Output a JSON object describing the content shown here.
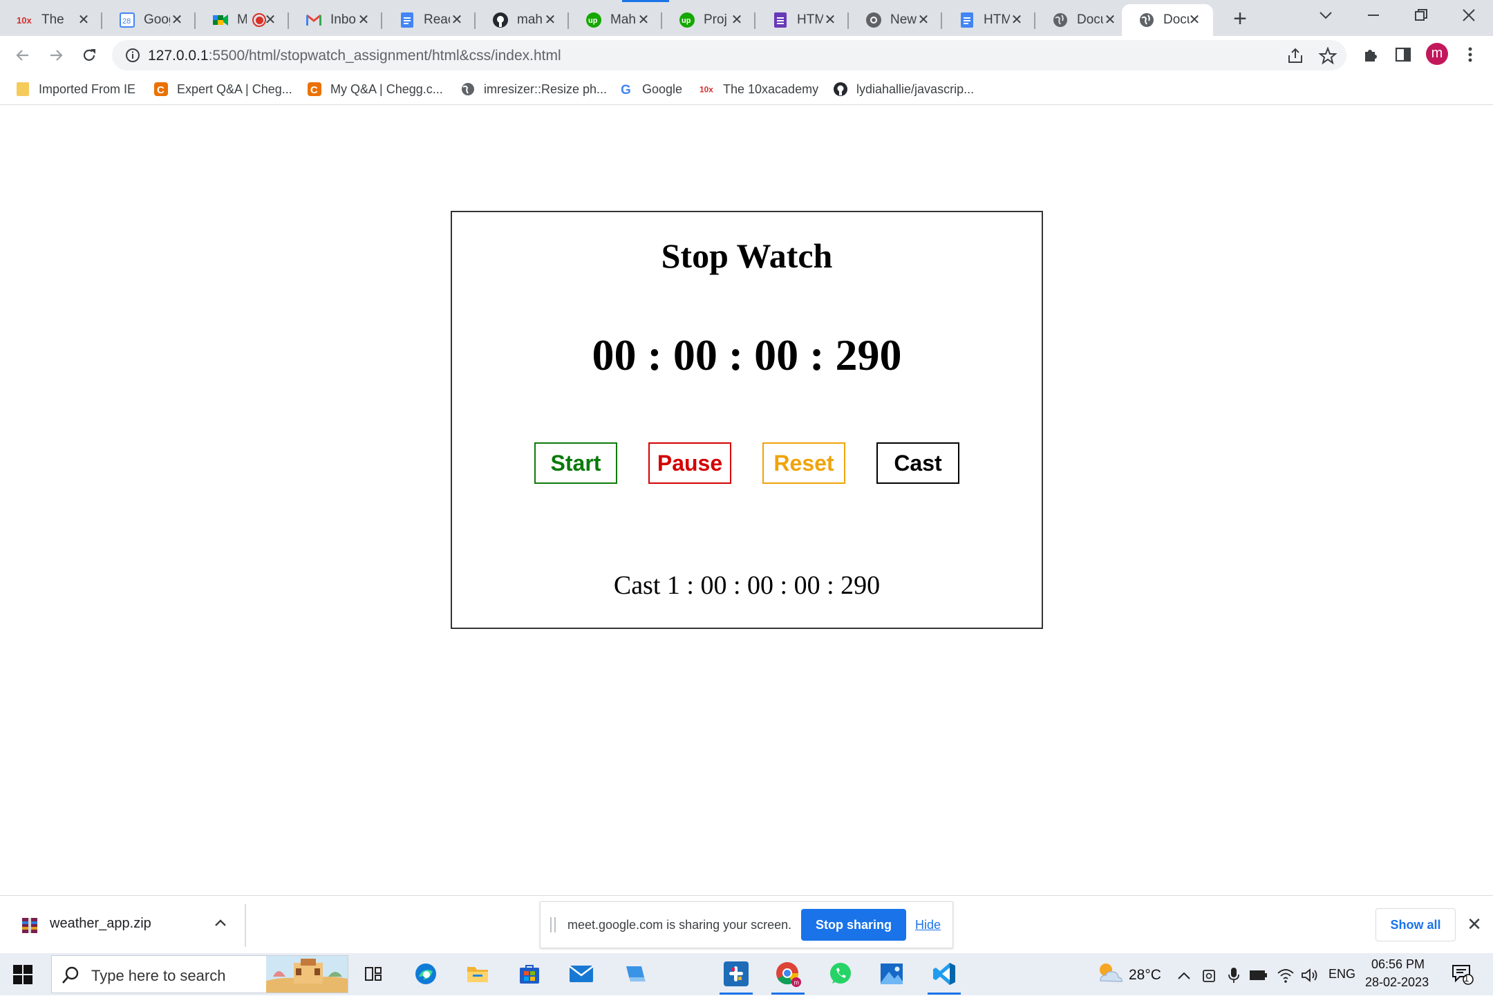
{
  "browser": {
    "tabs": [
      {
        "title": "The",
        "icon": "10x-icon"
      },
      {
        "title": "Goog",
        "icon": "calendar-icon"
      },
      {
        "title": "M",
        "icon": "meet-icon",
        "recording": true
      },
      {
        "title": "Inbo",
        "icon": "gmail-icon"
      },
      {
        "title": "Reac",
        "icon": "docs-icon"
      },
      {
        "title": "mah",
        "icon": "github-icon"
      },
      {
        "title": "Mah",
        "icon": "upwork-icon"
      },
      {
        "title": "Proj",
        "icon": "upwork-icon"
      },
      {
        "title": "HTM",
        "icon": "forms-icon"
      },
      {
        "title": "New",
        "icon": "chrome-icon"
      },
      {
        "title": "HTM",
        "icon": "docs-icon"
      },
      {
        "title": "Docu",
        "icon": "globe-icon"
      },
      {
        "title": "Docu",
        "icon": "globe-icon",
        "active": true
      }
    ],
    "url_host": "127.0.0.1",
    "url_path": ":5500/html/stopwatch_assignment/html&css/index.html",
    "avatar_letter": "m",
    "bookmarks": [
      {
        "label": "Imported From IE",
        "icon": "folder-icon"
      },
      {
        "label": "Expert Q&A | Cheg...",
        "icon": "chegg-icon"
      },
      {
        "label": "My Q&A | Chegg.c...",
        "icon": "chegg-icon"
      },
      {
        "label": "imresizer::Resize ph...",
        "icon": "globe-icon"
      },
      {
        "label": "Google",
        "icon": "google-icon"
      },
      {
        "label": "The 10xacademy",
        "icon": "10x-icon"
      },
      {
        "label": "lydiahallie/javascrip...",
        "icon": "github-icon"
      }
    ]
  },
  "stopwatch": {
    "title": "Stop Watch",
    "time": "00 : 00 : 00 : 290",
    "buttons": {
      "start": "Start",
      "pause": "Pause",
      "reset": "Reset",
      "cast": "Cast"
    },
    "colors": {
      "start": "#0a7a0a",
      "pause": "#d40000",
      "reset": "#f0a30a",
      "cast": "#000000"
    },
    "cast_entry": "Cast 1 : 00 : 00 : 00 : 290"
  },
  "download_bar": {
    "file_name": "weather_app.zip",
    "share_text": "meet.google.com is sharing your screen.",
    "stop_sharing": "Stop sharing",
    "hide": "Hide",
    "show_all": "Show all"
  },
  "taskbar": {
    "search_placeholder": "Type here to search",
    "temperature": "28°C",
    "language": "ENG",
    "time": "06:56 PM",
    "date": "28-02-2023",
    "notification_count": "1"
  }
}
